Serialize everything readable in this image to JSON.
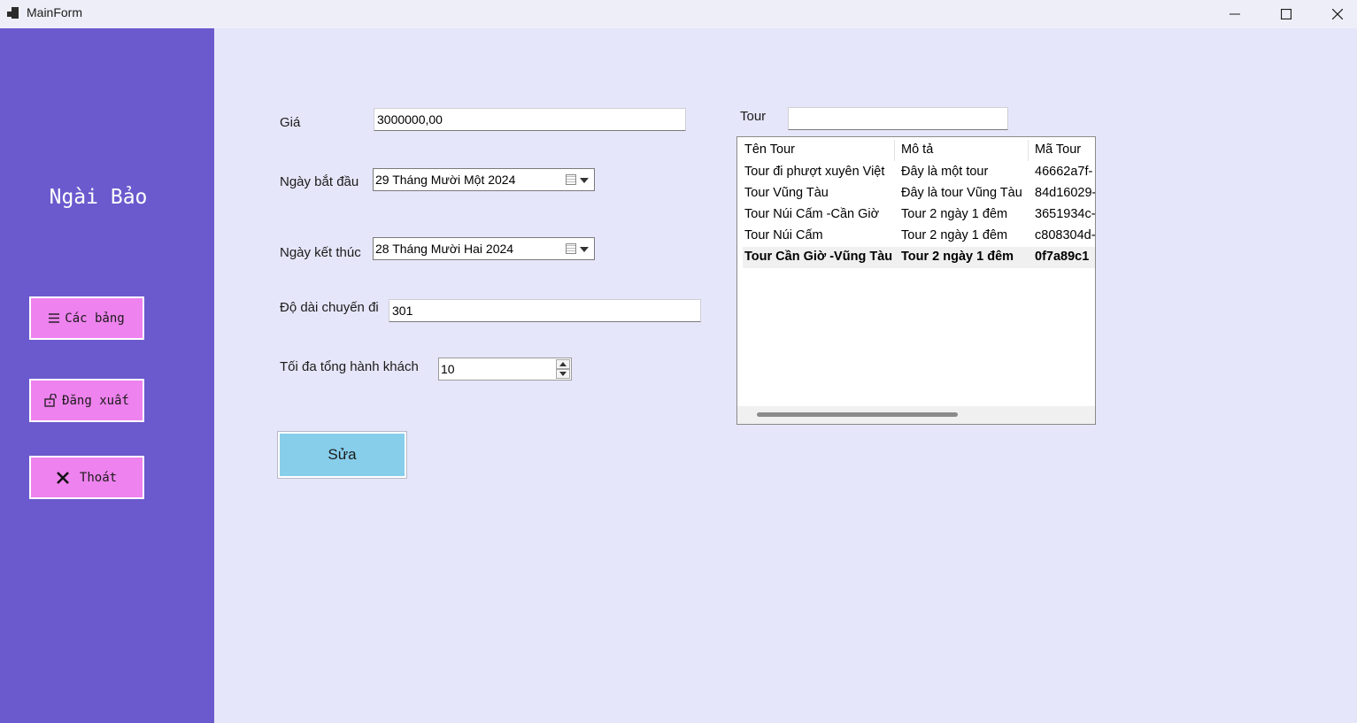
{
  "window": {
    "title": "MainForm"
  },
  "sidebar": {
    "user_name": "Ngài Bảo",
    "buttons": [
      {
        "label": "Các bảng",
        "icon": "hamburger-icon"
      },
      {
        "label": "Đăng xuất",
        "icon": "unlock-icon"
      },
      {
        "label": "Thoát",
        "icon": "close-x-icon"
      }
    ]
  },
  "form": {
    "price_label": "Giá",
    "price_value": "3000000,00",
    "start_label": "Ngày bắt đầu",
    "start_value": "29 Tháng Mười Một 2024",
    "end_label": "Ngày kết thúc",
    "end_value": "28 Tháng Mười Hai 2024",
    "length_label": "Độ dài chuyến đi",
    "length_value": "301",
    "max_label": "Tối đa tổng hành khách",
    "max_value": "10",
    "tour_label": "Tour",
    "tour_value": "",
    "submit_label": "Sửa"
  },
  "tour_list": {
    "columns": [
      "Tên Tour",
      "Mô tả",
      "Mã Tour"
    ],
    "rows": [
      [
        "Tour đi phượt xuyên Việt",
        "Đây là một tour",
        "46662a7f-"
      ],
      [
        "Tour Vũng Tàu",
        "Đây là tour Vũng Tàu",
        "84d16029-"
      ],
      [
        "Tour Núi Cấm -Cần Giờ",
        "Tour 2 ngày 1 đêm",
        "3651934c-"
      ],
      [
        "Tour Núi Cấm",
        "Tour 2 ngày 1 đêm",
        "c808304d-"
      ],
      [
        "Tour Cần Giờ -Vũng Tàu",
        "Tour 2 ngày 1 đêm",
        "0f7a89c1"
      ]
    ],
    "selected_row": 4
  },
  "colors": {
    "sidebar": "#6a5acd",
    "side_button": "#ee82ee",
    "main_button": "#87ceeb",
    "background": "#e6e6fa"
  }
}
